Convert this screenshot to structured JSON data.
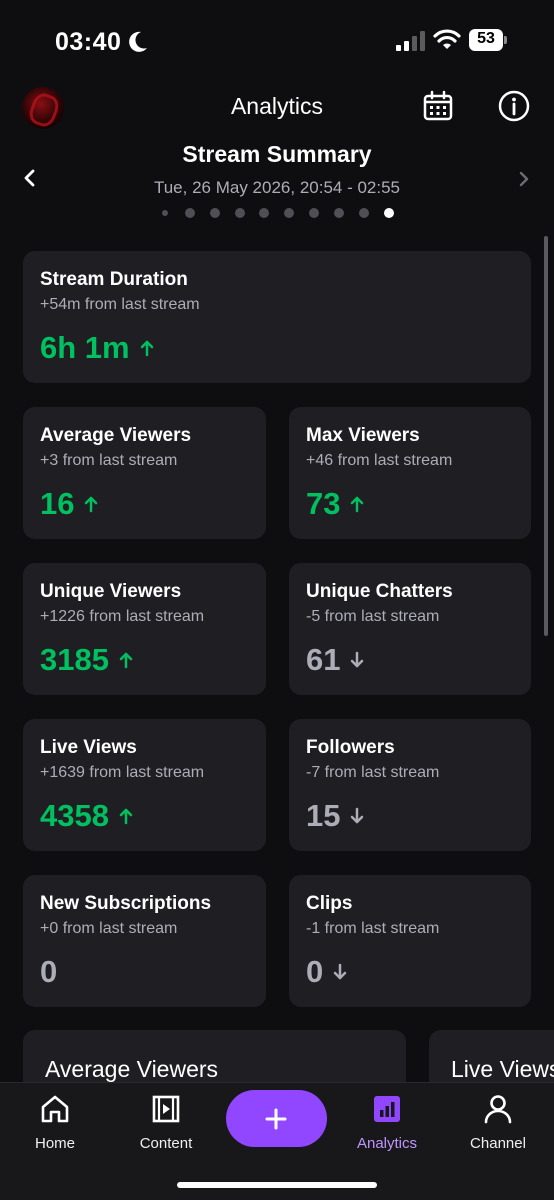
{
  "status_bar": {
    "time": "03:40",
    "battery": "53"
  },
  "header": {
    "title": "Analytics",
    "icons": [
      "calendar-icon",
      "info-icon"
    ]
  },
  "summary": {
    "title": "Stream Summary",
    "date_range": "Tue, 26 May 2026, 20:54 - 02:55",
    "page_count": 10,
    "active_page": 10
  },
  "cards": {
    "duration": {
      "title": "Stream Duration",
      "sub": "+54m from last stream",
      "value": "6h 1m",
      "trend": "up"
    },
    "avg_viewers": {
      "title": "Average Viewers",
      "sub": "+3 from last stream",
      "value": "16",
      "trend": "up"
    },
    "max_viewers": {
      "title": "Max Viewers",
      "sub": "+46 from last stream",
      "value": "73",
      "trend": "up"
    },
    "unique_viewers": {
      "title": "Unique Viewers",
      "sub": "+1226 from last stream",
      "value": "3185",
      "trend": "up"
    },
    "unique_chatters": {
      "title": "Unique Chatters",
      "sub": "-5 from last stream",
      "value": "61",
      "trend": "down"
    },
    "live_views": {
      "title": "Live Views",
      "sub": "+1639 from last stream",
      "value": "4358",
      "trend": "up"
    },
    "followers": {
      "title": "Followers",
      "sub": "-7 from last stream",
      "value": "15",
      "trend": "down"
    },
    "new_subs": {
      "title": "New Subscriptions",
      "sub": "+0 from last stream",
      "value": "0",
      "trend": "flat"
    },
    "clips": {
      "title": "Clips",
      "sub": "-1 from last stream",
      "value": "0",
      "trend": "down"
    }
  },
  "charts": {
    "first_title": "Average Viewers",
    "second_title": "Live Views"
  },
  "tabs": {
    "home": "Home",
    "content": "Content",
    "analytics": "Analytics",
    "channel": "Channel",
    "active": "analytics"
  },
  "colors": {
    "accent": "#9147ff",
    "up": "#00c05f",
    "muted": "#adadb8",
    "card": "#1f1f23",
    "background": "#0e0e10"
  }
}
